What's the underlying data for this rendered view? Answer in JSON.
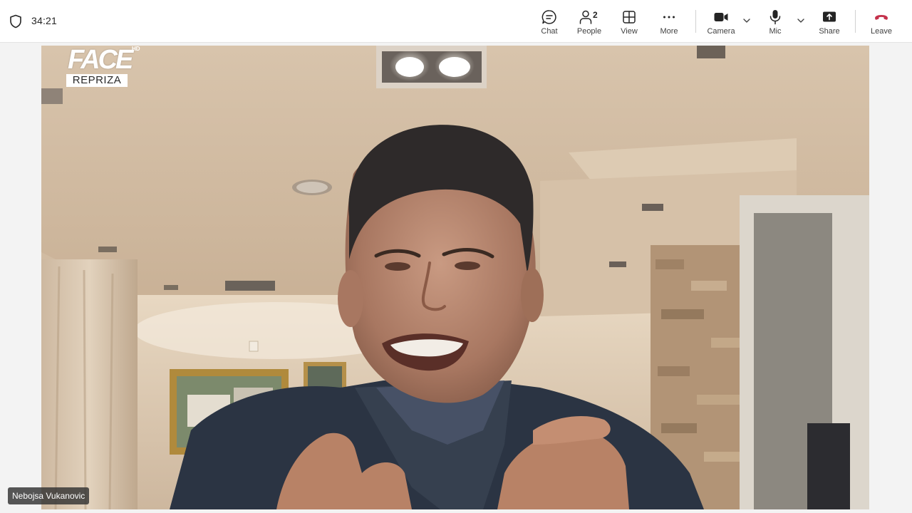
{
  "call": {
    "timer": "34:21"
  },
  "toolbar": {
    "chat_label": "Chat",
    "people_label": "People",
    "people_count": "2",
    "view_label": "View",
    "more_label": "More",
    "camera_label": "Camera",
    "mic_label": "Mic",
    "share_label": "Share",
    "leave_label": "Leave"
  },
  "video": {
    "channel_logo": "FACE",
    "channel_hd": "HD",
    "channel_tag": "REPRIZA",
    "participant_name": "Nebojsa Vukanovic"
  },
  "colors": {
    "leave_red": "#c4314b",
    "toolbar_bg": "#ffffff",
    "icon_color": "#242424"
  }
}
